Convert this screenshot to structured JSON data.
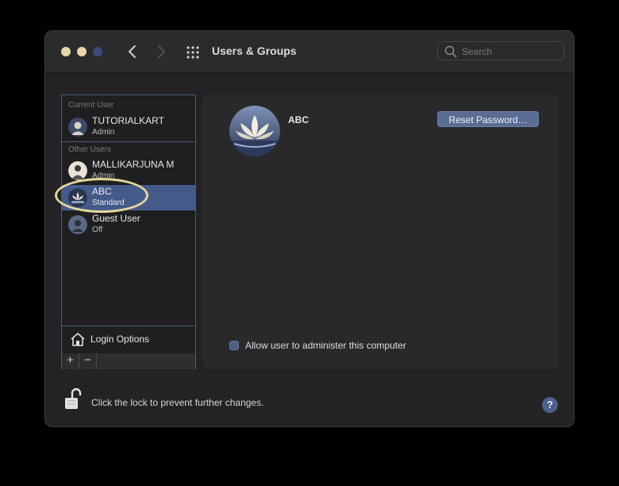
{
  "window": {
    "title": "Users & Groups",
    "search_placeholder": "Search"
  },
  "sidebar": {
    "current_user_label": "Current User",
    "other_users_label": "Other Users",
    "users": [
      {
        "name": "TUTORIALKART",
        "role": "Admin",
        "avatar": "user-avatar-icon"
      },
      {
        "name": "MALLIKARJUNA M",
        "role": "Admin",
        "avatar": "user-avatar-icon"
      },
      {
        "name": "ABC",
        "role": "Standard",
        "avatar": "lotus-avatar-icon",
        "selected": true
      },
      {
        "name": "Guest User",
        "role": "Off",
        "avatar": "guest-avatar-icon"
      }
    ],
    "login_options_label": "Login Options",
    "add_label": "+",
    "remove_label": "−"
  },
  "detail": {
    "user_name": "ABC",
    "reset_password_label": "Reset Password…",
    "allow_admin_label": "Allow user to administer this computer",
    "allow_admin_checked": false
  },
  "footer": {
    "lock_text": "Click the lock to prevent further changes.",
    "help_label": "?"
  },
  "colors": {
    "selection": "#445b8a",
    "accent": "#5a6c93",
    "highlight_ring": "#e3d59d"
  }
}
